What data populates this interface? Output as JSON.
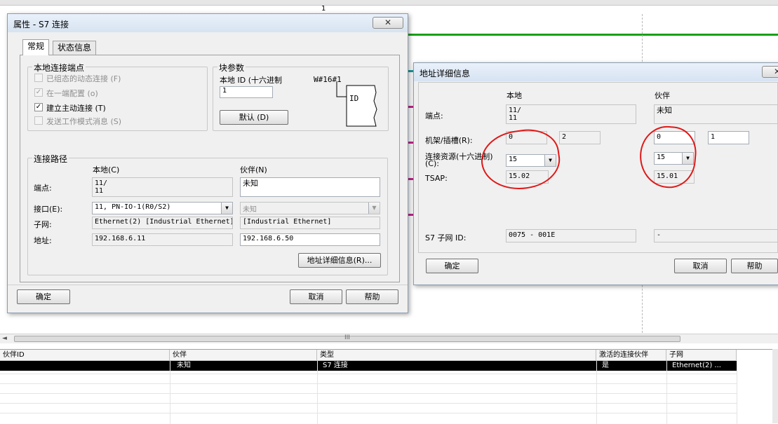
{
  "workspace": {
    "ruler_number": "1",
    "scroll_left_glyph": "◄",
    "scroll_grip_glyph": "III",
    "stub_colors": [
      "#1a9a9a",
      "#c0268c",
      "#c0268c",
      "#c0268c"
    ]
  },
  "conn_table": {
    "headers": [
      "伙伴ID",
      "伙伴",
      "类型",
      "激活的连接伙伴",
      "子网"
    ],
    "selected_row": [
      "",
      "未知",
      "S7 连接",
      "是",
      "Ethernet(2) ..."
    ]
  },
  "props_dialog": {
    "title": "属性 - S7 连接",
    "close_glyph": "✕",
    "tabs": [
      "常规",
      "状态信息"
    ],
    "local_endpoint": {
      "title": "本地连接端点",
      "checks": [
        {
          "label": "已组态的动态连接 (F)",
          "checked": "",
          "disabled": true
        },
        {
          "label": "在一端配置 (o)",
          "checked": "✓",
          "disabled": true
        },
        {
          "label": "建立主动连接 (T)",
          "checked": "✓",
          "disabled": false
        },
        {
          "label": "发送工作模式消息 (S)",
          "checked": "",
          "disabled": true
        }
      ]
    },
    "block_params": {
      "title": "块参数",
      "local_id_label": "本地 ID (十六进制",
      "local_id_value": "1",
      "hex_label": "W#16#1",
      "id_label": "ID",
      "default_button": "默认 (D)"
    },
    "conn_path": {
      "title": "连接路径",
      "local_header": "本地(C)",
      "partner_header": "伙伴(N)",
      "endpoint_label": "端点:",
      "local_endpoint": [
        "11/",
        "11"
      ],
      "partner_endpoint": "未知",
      "interface_label": "接口(E):",
      "local_interface": "11, PN-IO-1(R0/S2)",
      "partner_interface": "未知",
      "subnet_label": "子网:",
      "local_subnet": "Ethernet(2) [Industrial Ethernet]",
      "partner_subnet": "[Industrial Ethernet]",
      "address_label": "地址:",
      "local_address": "192.168.6.11",
      "partner_address": "192.168.6.50",
      "address_details_button": "地址详细信息(R)..."
    },
    "ok_button": "确定",
    "cancel_button": "取消",
    "help_button": "帮助"
  },
  "addr_dialog": {
    "title": "地址详细信息",
    "close_glyph": "✕",
    "local_header": "本地",
    "partner_header": "伙伴",
    "endpoint_label": "端点:",
    "local_endpoint": [
      "11/",
      "11"
    ],
    "partner_endpoint": "未知",
    "rack_slot_label": "机架/插槽(R):",
    "local_rack": "0",
    "local_slot": "2",
    "partner_rack": "0",
    "partner_slot": "1",
    "conn_resource_label": [
      "连接资源(十六进制)",
      "(C):"
    ],
    "local_resource": "15",
    "partner_resource": "15",
    "tsap_label": "TSAP:",
    "local_tsap": "15.02",
    "partner_tsap": "15.01",
    "s7_subnet_label": "S7 子网 ID:",
    "local_subnet_id": "0075 - 001E",
    "partner_subnet_id": "-",
    "ok_button": "确定",
    "cancel_button": "取消",
    "help_button": "帮助"
  }
}
